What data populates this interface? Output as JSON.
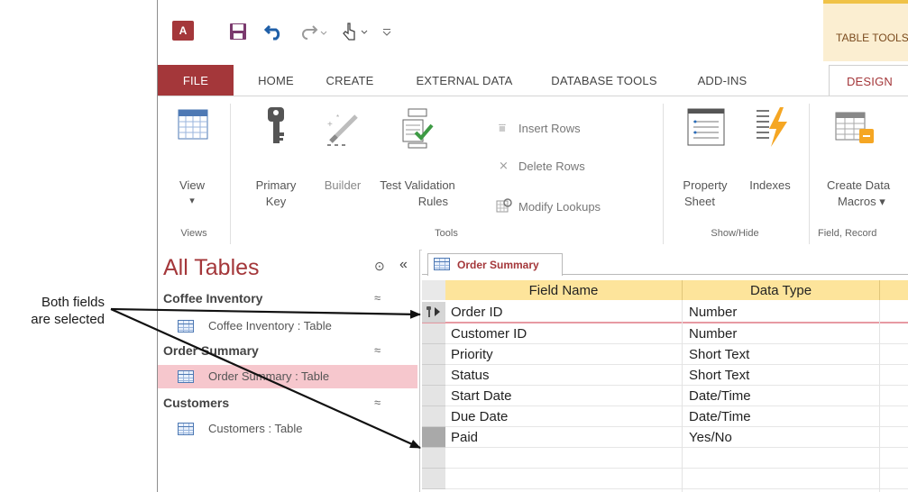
{
  "callout": {
    "line1": "Both fields",
    "line2": "are selected"
  },
  "qat": {
    "app_logo": "A"
  },
  "contextual_tab": {
    "label": "TABLE TOOLS"
  },
  "tabs": [
    {
      "label": "FILE"
    },
    {
      "label": "HOME"
    },
    {
      "label": "CREATE"
    },
    {
      "label": "EXTERNAL DATA"
    },
    {
      "label": "DATABASE TOOLS"
    },
    {
      "label": "ADD-INS"
    },
    {
      "label": "DESIGN"
    }
  ],
  "ribbon": {
    "view": {
      "label": "View",
      "arrow": "▾"
    },
    "primary_key": {
      "line1": "Primary",
      "line2": "Key"
    },
    "builder": {
      "label": "Builder"
    },
    "test_validation": {
      "line1": "Test Validation",
      "line2": "Rules"
    },
    "insert_rows": {
      "label": "Insert Rows"
    },
    "delete_rows": {
      "label": "Delete Rows"
    },
    "modify_lookups": {
      "label": "Modify Lookups"
    },
    "property_sheet": {
      "line1": "Property",
      "line2": "Sheet"
    },
    "indexes": {
      "label": "Indexes"
    },
    "create_data_macros": {
      "line1": "Create Data",
      "line2": "Macros ▾"
    },
    "groups": {
      "views": "Views",
      "tools": "Tools",
      "show_hide": "Show/Hide",
      "field_record": "Field, Record"
    }
  },
  "nav": {
    "title": "All Tables",
    "groups": [
      {
        "label": "Coffee Inventory",
        "item": "Coffee Inventory : Table"
      },
      {
        "label": "Order Summary",
        "item": "Order Summary : Table"
      },
      {
        "label": "Customers",
        "item": "Customers : Table"
      }
    ],
    "collapse_glyph": "≈",
    "menu_glyph": "⊙",
    "shutter_glyph": "«"
  },
  "document": {
    "tab_label": "Order Summary",
    "headers": {
      "field_name": "Field Name",
      "data_type": "Data Type"
    },
    "rows": [
      {
        "field": "Order ID",
        "type": "Number"
      },
      {
        "field": "Customer ID",
        "type": "Number"
      },
      {
        "field": "Priority",
        "type": "Short Text"
      },
      {
        "field": "Status",
        "type": "Short Text"
      },
      {
        "field": "Start Date",
        "type": "Date/Time"
      },
      {
        "field": "Due Date",
        "type": "Date/Time"
      },
      {
        "field": "Paid",
        "type": "Yes/No"
      }
    ]
  },
  "colors": {
    "accent": "#a4373a",
    "header": "#fde49b",
    "selected": "#f6c7cd"
  }
}
